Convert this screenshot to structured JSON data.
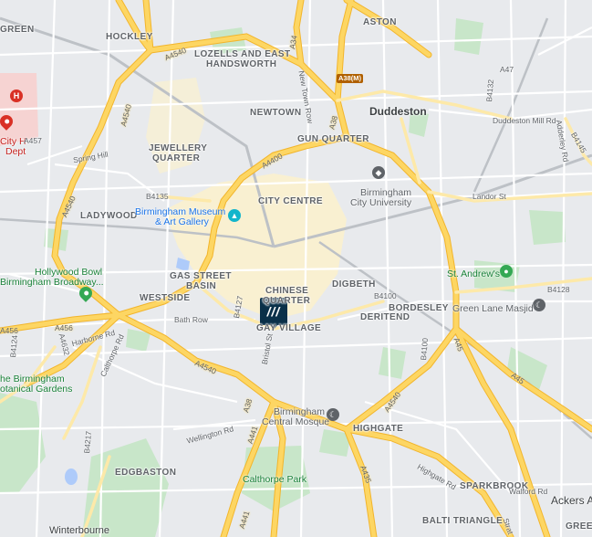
{
  "map": {
    "districts": [
      {
        "id": "hockley",
        "text": "HOCKLEY"
      },
      {
        "id": "lozells",
        "text": "LOZELLS AND EAST"
      },
      {
        "id": "handsworth",
        "text": "HANDSWORTH"
      },
      {
        "id": "aston",
        "text": "ASTON"
      },
      {
        "id": "green",
        "text": "GREEN"
      },
      {
        "id": "newtown",
        "text": "NEWTOWN"
      },
      {
        "id": "jewellery1",
        "text": "JEWELLERY"
      },
      {
        "id": "jewellery2",
        "text": "QUARTER"
      },
      {
        "id": "gunquarter",
        "text": "GUN QUARTER"
      },
      {
        "id": "ladywood",
        "text": "LADYWOOD"
      },
      {
        "id": "citycentre",
        "text": "CITY CENTRE"
      },
      {
        "id": "gasstreet1",
        "text": "GAS STREET"
      },
      {
        "id": "gasstreet2",
        "text": "BASIN"
      },
      {
        "id": "westside",
        "text": "WESTSIDE"
      },
      {
        "id": "chinese1",
        "text": "CHINESE"
      },
      {
        "id": "chinese2",
        "text": "QUARTER"
      },
      {
        "id": "digbeth",
        "text": "DIGBETH"
      },
      {
        "id": "bordesley",
        "text": "BORDESLEY"
      },
      {
        "id": "deritend",
        "text": "DERITEND"
      },
      {
        "id": "gayvillage",
        "text": "GAY VILLAGE"
      },
      {
        "id": "highgate",
        "text": "HIGHGATE"
      },
      {
        "id": "edgbaston",
        "text": "EDGBASTON"
      },
      {
        "id": "sparkbrook",
        "text": "SPARKBROOK"
      },
      {
        "id": "balti",
        "text": "BALTI TRIANGLE"
      },
      {
        "id": "greet",
        "text": "GREET"
      }
    ],
    "areas": [
      {
        "id": "duddeston",
        "text": "Duddeston"
      },
      {
        "id": "ackers",
        "text": "Ackers Ad"
      },
      {
        "id": "winterbourne",
        "text": "Winterbourne"
      }
    ],
    "pois": [
      {
        "id": "bcu1",
        "text": "Birmingham"
      },
      {
        "id": "bcu2",
        "text": "City University"
      },
      {
        "id": "museum1",
        "text": "Birmingham Museum"
      },
      {
        "id": "museum2",
        "text": "& Art Gallery"
      },
      {
        "id": "hollywood1",
        "text": "Hollywood Bowl"
      },
      {
        "id": "hollywood2",
        "text": "Birmingham Broadway..."
      },
      {
        "id": "standrews",
        "text": "St. Andrew's"
      },
      {
        "id": "greenlane",
        "text": "Green Lane Masjid"
      },
      {
        "id": "mosque1",
        "text": "Birmingham"
      },
      {
        "id": "mosque2",
        "text": "Central Mosque"
      },
      {
        "id": "calthorpe",
        "text": "Calthorpe Park"
      },
      {
        "id": "botanical1",
        "text": "he Birmingham"
      },
      {
        "id": "botanical2",
        "text": "otanical Gardens"
      },
      {
        "id": "cityhosp1",
        "text": "City H"
      },
      {
        "id": "cityhosp2",
        "text": "Dept"
      }
    ],
    "roads": [
      {
        "id": "a4540a",
        "text": "A4540"
      },
      {
        "id": "a4540b",
        "text": "A4540"
      },
      {
        "id": "a4540c",
        "text": "A4540"
      },
      {
        "id": "a4540d",
        "text": "A4540"
      },
      {
        "id": "a4540e",
        "text": "A4540"
      },
      {
        "id": "a34",
        "text": "A34"
      },
      {
        "id": "a38m",
        "text": "A38(M)"
      },
      {
        "id": "a38a",
        "text": "A38"
      },
      {
        "id": "a38b",
        "text": "A38"
      },
      {
        "id": "a47",
        "text": "A47"
      },
      {
        "id": "a4400",
        "text": "A4400"
      },
      {
        "id": "a456a",
        "text": "A456"
      },
      {
        "id": "a456b",
        "text": "A456"
      },
      {
        "id": "a457",
        "text": "A457"
      },
      {
        "id": "a441a",
        "text": "A441"
      },
      {
        "id": "a441b",
        "text": "A441"
      },
      {
        "id": "a435",
        "text": "A435"
      },
      {
        "id": "a45a",
        "text": "A45"
      },
      {
        "id": "a45b",
        "text": "A45"
      },
      {
        "id": "b4100",
        "text": "B4100"
      },
      {
        "id": "b4132",
        "text": "B4132"
      },
      {
        "id": "b4135",
        "text": "B4135"
      },
      {
        "id": "b4127",
        "text": "B4127"
      },
      {
        "id": "b4128",
        "text": "B4128"
      },
      {
        "id": "b4145",
        "text": "B4145"
      },
      {
        "id": "b4124",
        "text": "B4124"
      },
      {
        "id": "b4217",
        "text": "B4217"
      },
      {
        "id": "b4100b",
        "text": "B4100"
      },
      {
        "id": "a4632",
        "text": "A4632"
      },
      {
        "id": "springhill",
        "text": "Spring Hill"
      },
      {
        "id": "newtownrow",
        "text": "New Town Row"
      },
      {
        "id": "duddestonmill",
        "text": "Duddeston Mill Rd"
      },
      {
        "id": "landorst",
        "text": "Landor St"
      },
      {
        "id": "bathrow",
        "text": "Bath Row"
      },
      {
        "id": "bristolst",
        "text": "Bristol St"
      },
      {
        "id": "harborne",
        "text": "Harborne Rd"
      },
      {
        "id": "calthorperd",
        "text": "Calthorpe Rd"
      },
      {
        "id": "wellington",
        "text": "Wellington Rd"
      },
      {
        "id": "highgaterd",
        "text": "Highgate Rd"
      },
      {
        "id": "walfordrd",
        "text": "Walford Rd"
      },
      {
        "id": "adderley",
        "text": "Adderley Rd"
      },
      {
        "id": "stratford",
        "text": "Strat"
      }
    ],
    "marker": {
      "text": "///"
    },
    "colors": {
      "land": "#e8eaed",
      "park": "#c8e6c9",
      "major_road": "#fdd663",
      "major_road_edge": "#f2b52c",
      "minor_road": "#ffffff",
      "rail": "#bdc1c6",
      "water": "#aecbfa",
      "center": "#fdf1c9",
      "hospital": "#f6d3d2",
      "marker": "#0a3049"
    }
  }
}
